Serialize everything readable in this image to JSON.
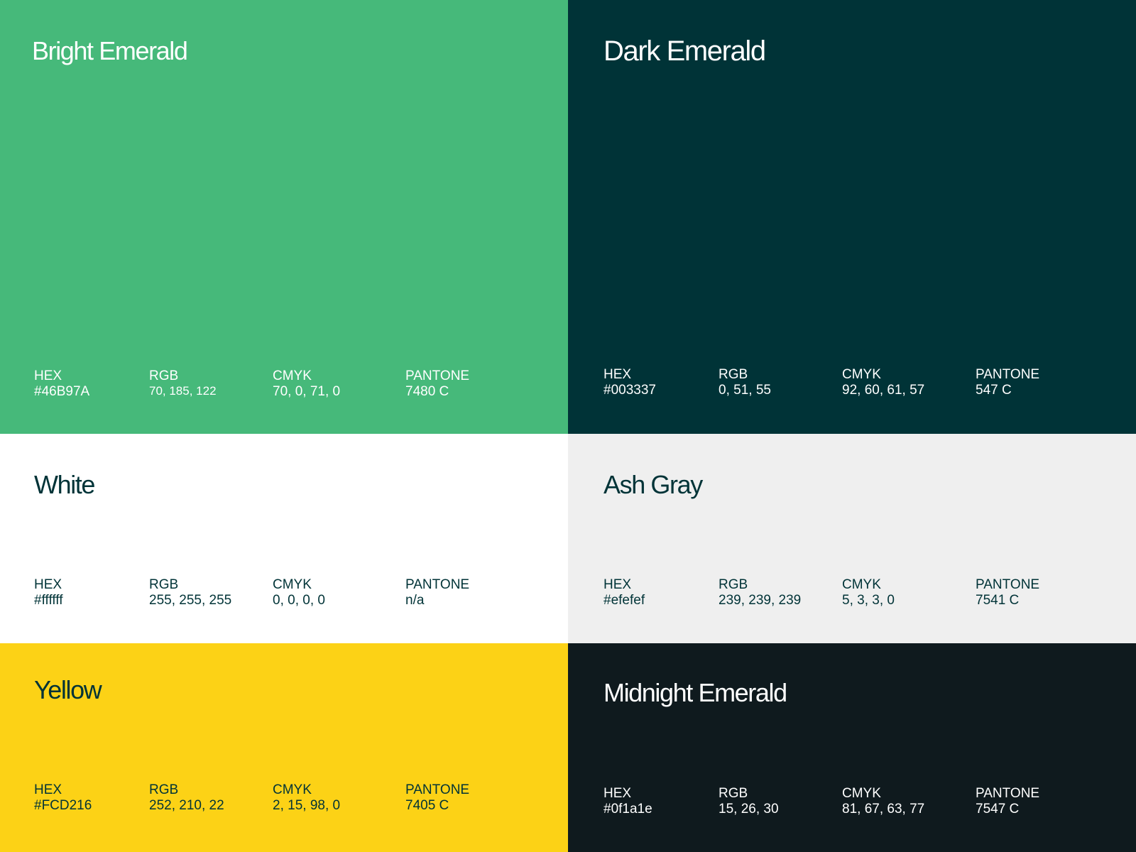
{
  "swatches": [
    {
      "name": "Bright Emerald",
      "background": "#46B97A",
      "text_color": "#ffffff",
      "hex_label": "HEX",
      "hex_value": "#46B97A",
      "rgb_label": "RGB",
      "rgb_value": "70, 185, 122",
      "cmyk_label": "CMYK",
      "cmyk_value": "70, 0, 71, 0",
      "pantone_label": "PANTONE",
      "pantone_value": "7480 C"
    },
    {
      "name": "Dark Emerald",
      "background": "#003337",
      "text_color": "#ffffff",
      "hex_label": "HEX",
      "hex_value": "#003337",
      "rgb_label": "RGB",
      "rgb_value": "0, 51, 55",
      "cmyk_label": "CMYK",
      "cmyk_value": "92, 60, 61, 57",
      "pantone_label": "PANTONE",
      "pantone_value": "547 C"
    },
    {
      "name": "White",
      "background": "#ffffff",
      "text_color": "#003337",
      "hex_label": "HEX",
      "hex_value": "#ffffff",
      "rgb_label": "RGB",
      "rgb_value": "255, 255, 255",
      "cmyk_label": "CMYK",
      "cmyk_value": "0, 0, 0, 0",
      "pantone_label": "PANTONE",
      "pantone_value": "n/a"
    },
    {
      "name": "Ash Gray",
      "background": "#efefef",
      "text_color": "#003337",
      "hex_label": "HEX",
      "hex_value": "#efefef",
      "rgb_label": "RGB",
      "rgb_value": "239, 239, 239",
      "cmyk_label": "CMYK",
      "cmyk_value": "5, 3, 3, 0",
      "pantone_label": "PANTONE",
      "pantone_value": "7541 C"
    },
    {
      "name": "Yellow",
      "background": "#FCD216",
      "text_color": "#003337",
      "hex_label": "HEX",
      "hex_value": "#FCD216",
      "rgb_label": "RGB",
      "rgb_value": "252, 210, 22",
      "cmyk_label": "CMYK",
      "cmyk_value": "2, 15, 98, 0",
      "pantone_label": "PANTONE",
      "pantone_value": "7405 C"
    },
    {
      "name": "Midnight Emerald",
      "background": "#0f1a1e",
      "text_color": "#ffffff",
      "hex_label": "HEX",
      "hex_value": "#0f1a1e",
      "rgb_label": "RGB",
      "rgb_value": "15, 26, 30",
      "cmyk_label": "CMYK",
      "cmyk_value": "81, 67, 63, 77",
      "pantone_label": "PANTONE",
      "pantone_value": "7547 C"
    }
  ]
}
